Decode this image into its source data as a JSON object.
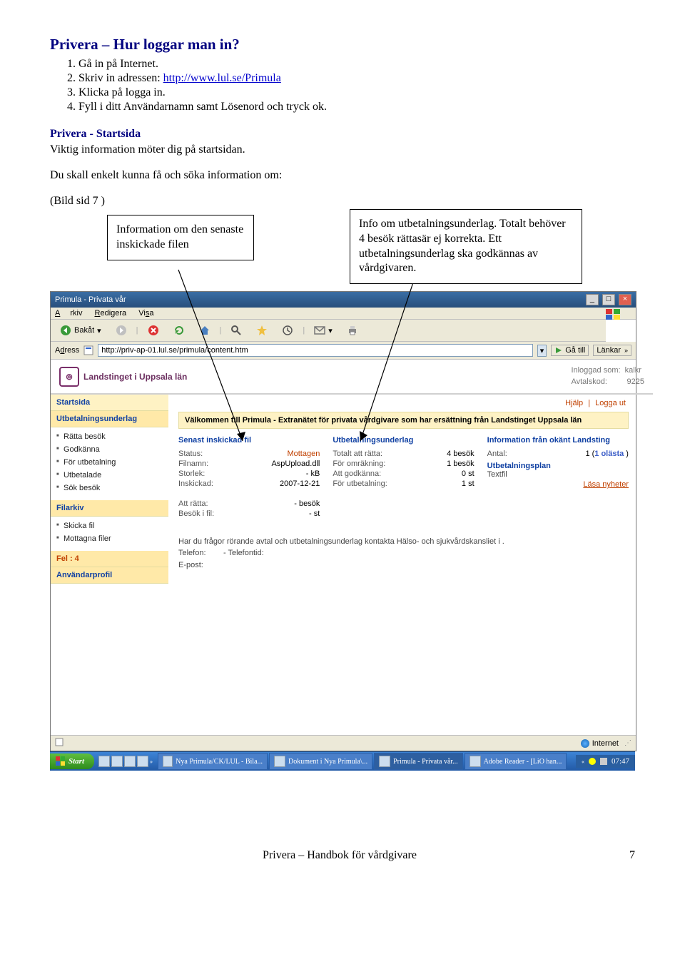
{
  "doc": {
    "heading": "Privera – Hur loggar man in?",
    "steps": [
      "Gå in på Internet.",
      "Skriv in adressen: ",
      "Klicka på logga in.",
      "Fyll i ditt Användarnamn samt Lösenord och tryck ok."
    ],
    "step2_link": "http://www.lul.se/Primula",
    "section_title": "Privera - Startsida",
    "section_intro": "Viktig information möter dig på startsidan.",
    "section_intro2": "Du skall enkelt kunna få och söka information om:",
    "bild_ref": "(Bild sid 7 )",
    "callout1": "Information om den senaste inskickade filen",
    "callout2": "Info om utbetalningsunderlag. Totalt behöver 4 besök rättasär ej korrekta. Ett utbetalningsunderlag ska godkännas av vårdgivaren.",
    "footer": "Privera – Handbok för vårdgivare",
    "page_number": "7"
  },
  "browser": {
    "title": "Primula - Privata vår",
    "menu": {
      "file": "Arkiv",
      "edit": "Redigera",
      "view": "Visa"
    },
    "toolbar": {
      "back": "Bakåt"
    },
    "address_label": "Adress",
    "address_value": "http://priv-ap-01.lul.se/primula/content.htm",
    "go": "Gå till",
    "links": "Länkar",
    "status_right": "Internet"
  },
  "page": {
    "logo_text": "Landstinget i Uppsala län",
    "logged_in_label": "Inloggad som:",
    "logged_in_user": "kalkr",
    "avtal_label": "Avtalskod:",
    "avtal_value": "9225",
    "top_links": {
      "help": "Hjälp",
      "logout": "Logga ut"
    },
    "welcome": "Välkommen till Primula - Extranätet för privata vårdgivare som har ersättning från Landstinget Uppsala län",
    "sidebar": {
      "start": "Startsida",
      "utbet": "Utbetalningsunderlag",
      "items1": [
        "Rätta besök",
        "Godkänna",
        "För utbetalning",
        "Utbetalade",
        "Sök besök"
      ],
      "filarkiv": "Filarkiv",
      "items2": [
        "Skicka fil",
        "Mottagna filer"
      ],
      "fel": "Fel : 4",
      "profil": "Användarprofil"
    },
    "col1": {
      "title": "Senast inskickad fil",
      "rows": [
        {
          "k": "Status:",
          "v": "Mottagen",
          "cls": "orange"
        },
        {
          "k": "Filnamn:",
          "v": "AspUpload.dll"
        },
        {
          "k": "Storlek:",
          "v": "- kB"
        },
        {
          "k": "Inskickad:",
          "v": "2007-12-21"
        }
      ],
      "extra": [
        {
          "k": "Att rätta:",
          "v": "- besök"
        },
        {
          "k": "Besök i fil:",
          "v": "- st"
        }
      ]
    },
    "col2": {
      "title": "Utbetalningsunderlag",
      "rows": [
        {
          "k": "Totalt att rätta:",
          "v": "4 besök"
        },
        {
          "k": "För omräkning:",
          "v": "1 besök"
        },
        {
          "k": "Att godkänna:",
          "v": "0 st"
        },
        {
          "k": "För utbetalning:",
          "v": "1 st"
        }
      ]
    },
    "col3": {
      "title": "Information från okänt Landsting",
      "antal_k": "Antal:",
      "antal_v": "1 (",
      "unread": "1 olästa",
      "closep": " )",
      "sub1": "Utbetalningsplan",
      "sub2": "Textfil",
      "nyheter": "Läsa nyheter"
    },
    "contact": {
      "line1": "Har du frågor rörande avtal och utbetalningsunderlag kontakta Hälso- och sjukvårdskansliet i .",
      "tel_k": "Telefon:",
      "tel_v": "- Telefontid:",
      "ep_k": "E-post:"
    }
  },
  "taskbar": {
    "start": "Start",
    "items": [
      "Nya Primula/CK/LUL - Bila...",
      "Dokument i Nya Primula\\...",
      "Primula - Privata vår...",
      "Adobe Reader - [LiO han..."
    ],
    "clock": "07:47"
  }
}
